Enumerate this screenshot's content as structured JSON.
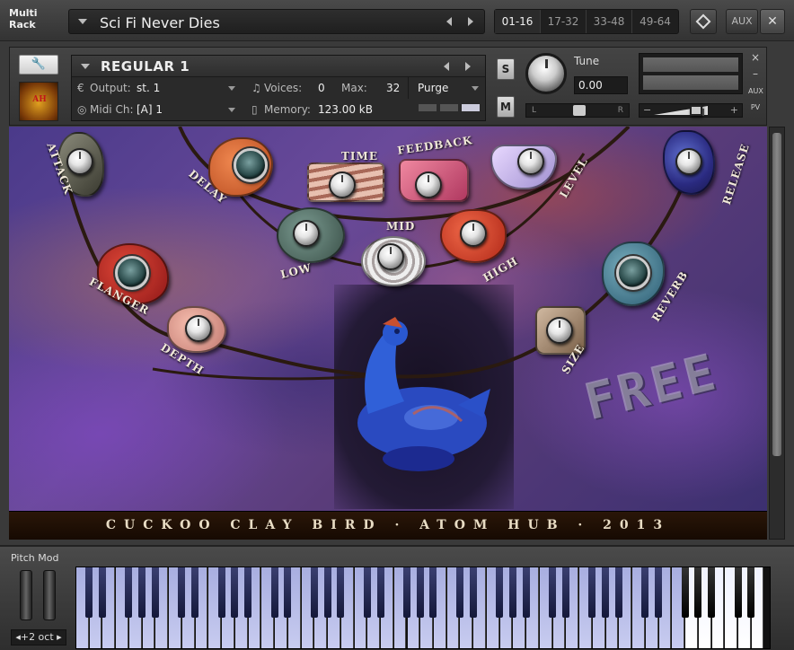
{
  "multirack": {
    "title_line1": "Multi",
    "title_line2": "Rack",
    "rack_name": "Sci Fi Never Dies",
    "pages": [
      "01-16",
      "17-32",
      "33-48",
      "49-64"
    ],
    "active_page": "01-16",
    "aux_label": "AUX",
    "close_label": "✕"
  },
  "instrument": {
    "name": "REGULAR 1",
    "output_label": "Output:",
    "output_value": "st. 1",
    "voices_label": "Voices:",
    "voices_value": "0",
    "max_label": "Max:",
    "max_value": "32",
    "purge_label": "Purge",
    "midi_label": "Midi Ch:",
    "midi_value": "[A]  1",
    "memory_label": "Memory:",
    "memory_value": "123.00 kB",
    "solo_label": "S",
    "mute_label": "M",
    "tune_label": "Tune",
    "tune_value": "0.00",
    "pan_left": "L",
    "pan_right": "R",
    "side_close": "×",
    "side_min": "–",
    "side_aux": "AUX",
    "side_pv": "PV",
    "logo_text": "AH"
  },
  "gui": {
    "labels": {
      "attack": "ATTACK",
      "delay": "DELAY",
      "time": "TIME",
      "feedback": "FEEDBACK",
      "level": "LEVEL",
      "release": "RELEASE",
      "low": "LOW",
      "mid": "MID",
      "high": "HIGH",
      "flanger": "FLANGER",
      "depth": "DEPTH",
      "reverb": "REVERB",
      "size": "SIZE"
    },
    "free_text": "FREE",
    "footer_text": "CUCKOO CLAY BIRD · ATOM HUB · 2013"
  },
  "keyboard": {
    "pitch_mod_label": "Pitch Mod",
    "octave_label": "◂+2 oct ▸"
  }
}
